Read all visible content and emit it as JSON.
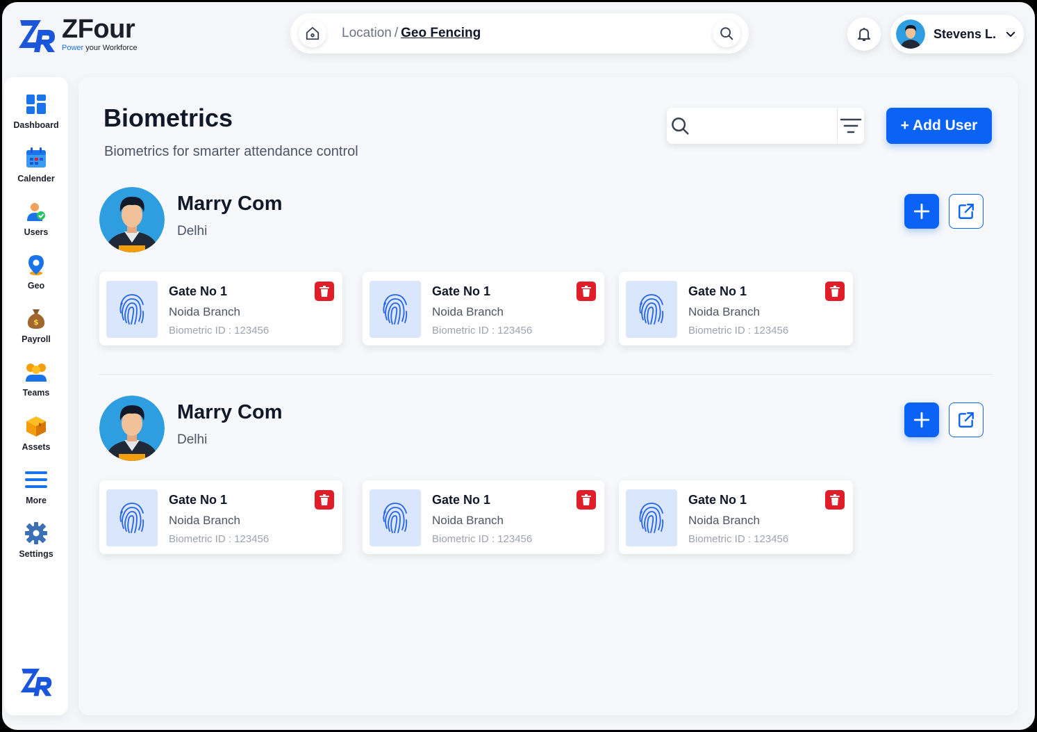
{
  "brand": {
    "name": "ZFour",
    "tagline_prefix": "Power",
    "tagline_rest": " your Workforce",
    "accent": "#0b63f6"
  },
  "header": {
    "breadcrumb_root": "Location",
    "breadcrumb_sep": "/",
    "breadcrumb_current": "Geo Fencing",
    "user_name": "Stevens L."
  },
  "sidebar": {
    "items": [
      {
        "label": "Dashboard",
        "icon": "dashboard-icon"
      },
      {
        "label": "Calender",
        "icon": "calendar-icon"
      },
      {
        "label": "Users",
        "icon": "users-icon"
      },
      {
        "label": "Geo",
        "icon": "geo-pin-icon"
      },
      {
        "label": "Payroll",
        "icon": "money-bag-icon"
      },
      {
        "label": "Teams",
        "icon": "teams-icon"
      },
      {
        "label": "Assets",
        "icon": "box-icon"
      },
      {
        "label": "More",
        "icon": "menu-icon"
      },
      {
        "label": "Settings",
        "icon": "gear-icon"
      }
    ]
  },
  "page": {
    "title": "Biometrics",
    "subtitle": "Biometrics for smarter attendance control",
    "search_placeholder": "",
    "add_user_label": "+ Add User"
  },
  "groups": [
    {
      "name": "Marry Com",
      "city": "Delhi",
      "devices": [
        {
          "gate": "Gate No 1",
          "branch": "Noida Branch",
          "biometric_id": "Biometric ID : 123456"
        },
        {
          "gate": "Gate No 1",
          "branch": "Noida Branch",
          "biometric_id": "Biometric ID : 123456"
        },
        {
          "gate": "Gate No 1",
          "branch": "Noida Branch",
          "biometric_id": "Biometric ID : 123456"
        }
      ]
    },
    {
      "name": "Marry Com",
      "city": "Delhi",
      "devices": [
        {
          "gate": "Gate No 1",
          "branch": "Noida Branch",
          "biometric_id": "Biometric ID : 123456"
        },
        {
          "gate": "Gate No 1",
          "branch": "Noida Branch",
          "biometric_id": "Biometric ID : 123456"
        },
        {
          "gate": "Gate No 1",
          "branch": "Noida Branch",
          "biometric_id": "Biometric ID : 123456"
        }
      ]
    }
  ]
}
